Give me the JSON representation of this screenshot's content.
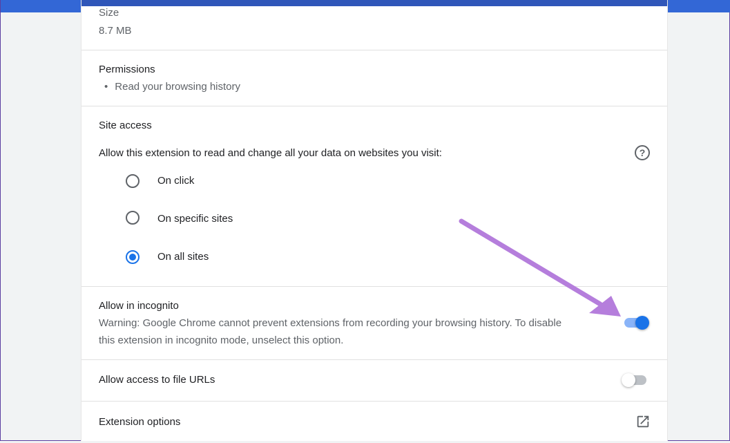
{
  "size": {
    "label": "Size",
    "value": "8.7 MB"
  },
  "permissions": {
    "label": "Permissions",
    "items": [
      "Read your browsing history"
    ]
  },
  "site_access": {
    "label": "Site access",
    "description": "Allow this extension to read and change all your data on websites you visit:",
    "help_icon": "help-circle-icon",
    "options": [
      {
        "label": "On click",
        "checked": false
      },
      {
        "label": "On specific sites",
        "checked": false
      },
      {
        "label": "On all sites",
        "checked": true
      }
    ]
  },
  "incognito": {
    "label": "Allow in incognito",
    "warning_line1": "Warning: Google Chrome cannot prevent extensions from recording your browsing history. To disable",
    "warning_line2": "this extension in incognito mode, unselect this option.",
    "enabled": true
  },
  "file_urls": {
    "label": "Allow access to file URLs",
    "enabled": false
  },
  "extension_options": {
    "label": "Extension options",
    "icon": "open-in-new-icon"
  },
  "colors": {
    "accent": "#1a73e8",
    "toggle_track_on": "#8ab4f8",
    "header": "#3367d6",
    "annotation_arrow": "#b57edc"
  }
}
